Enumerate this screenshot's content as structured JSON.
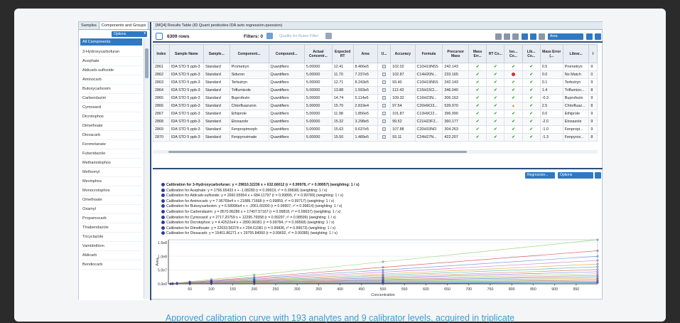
{
  "left_panel": {
    "tabs": [
      "Samples",
      "Components and Groups"
    ],
    "dropdown": "Options",
    "selected": "All Components",
    "items": [
      "3-Hydroxycarbofuran",
      "Acephate",
      "Aldicarb-sulfoxide",
      "Aminocarb",
      "Butoxycarboxim",
      "Carbendazim",
      "Cymoxanil",
      "Dicrotophos",
      "Dimethoate",
      "Dioxacarb",
      "Fenmetanate",
      "Fuberidazole",
      "Methamidophos",
      "Methomyl",
      "Mevinphos",
      "Monocrotophos",
      "Omethoate",
      "Oxamyl",
      "Propamocarb",
      "Thiabendazole",
      "Tricyclazole",
      "Vamidothion",
      "Aldicarb",
      "Bendiocarb"
    ]
  },
  "results": {
    "title": "[MQ4] Results Table (ID Quant pesticides IDA avto regression.qsession)",
    "rows_label": "6309 rows",
    "filters_label": "Filters: 0",
    "quality_filter": "Quality for Rules Filter",
    "metric_dropdown": "Area",
    "columns": [
      "Index",
      "Sample Name",
      "Sample...",
      "Component...",
      "Compound...",
      "Actual Concentr...",
      "Expected RT",
      "Area",
      "U...",
      "Accuracy",
      "Formula",
      "Precursor Mass",
      "Mass Err...",
      "RT Co...",
      "Iso... Co...",
      "Lib... Co...",
      "Mass Error (...",
      "Librar...",
      "I"
    ],
    "rows": [
      [
        "2861",
        "IDA STD 5 ppb-3",
        "Standard",
        "Prometryn",
        "Quantifiers",
        "5.00000",
        "12.41",
        "8.466e5",
        "",
        "102.02",
        "C10H19N5S",
        "242.143",
        "ok",
        "ok",
        "ok",
        "ok",
        "0.5",
        "Prometryn",
        "9"
      ],
      [
        "2862",
        "IDA STD 5 ppb-3",
        "Standard",
        "Siduron",
        "Quantifiers",
        "5.00000",
        "11.70",
        "7.237e5",
        "",
        "102.87",
        "C14H20N...",
        "233.165",
        "ok",
        "ok",
        "err",
        "ok",
        "0.0",
        "No Match",
        "0"
      ],
      [
        "2863",
        "IDA STD 5 ppb-3",
        "Standard",
        "Terbutryn",
        "Quantifiers",
        "5.00000",
        "12.71",
        "8.243e5",
        "",
        "93.40",
        "C10H19N5S",
        "242.143",
        "ok",
        "ok",
        "ok",
        "ok",
        "0.1",
        "Terbutryn",
        "9"
      ],
      [
        "2864",
        "IDA STD 5 ppb-3",
        "Standard",
        "Triflumizole",
        "Quantifiers",
        "5.00000",
        "13.88",
        "1.593e5",
        "",
        "112.43",
        "C15H15Cl...",
        "346.040",
        "ok",
        "ok",
        "ok",
        "ok",
        "1.4",
        "Triflumizo...",
        "8"
      ],
      [
        "2865",
        "IDA STD 5 ppb-3",
        "Standard",
        "Buprofezin",
        "Quantifiers",
        "5.00000",
        "14.74",
        "5.114e5",
        "",
        "109.32",
        "C16H23N...",
        "306.163",
        "ok",
        "ok",
        "ok",
        "ok",
        "-0.3",
        "Buprofezin",
        "9"
      ],
      [
        "2866",
        "IDA STD 5 ppb-3",
        "Standard",
        "Chlorfluazuron",
        "Quantifiers",
        "5.00000",
        "15.70",
        "2.819e4",
        "",
        "97.54",
        "C20H9Cl3...",
        "539.970",
        "ok",
        "ok",
        "warn",
        "ok",
        "2.5",
        "Chlorfluaz...",
        "8"
      ],
      [
        "2867",
        "IDA STD 5 ppb-3",
        "Standard",
        "Ethiprole",
        "Quantifiers",
        "5.00000",
        "11.98",
        "1.856e5",
        "",
        "101.87",
        "C13H9Cl2...",
        "396.990",
        "ok",
        "ok",
        "ok",
        "ok",
        "0.0",
        "Ethiprole",
        "9"
      ],
      [
        "2868",
        "IDA STD 5 ppb-3",
        "Standard",
        "Etoxazole",
        "Quantifiers",
        "5.00000",
        "15.32",
        "3.298e5",
        "",
        "99.52",
        "C21H23F2...",
        "360.177",
        "ok",
        "ok",
        "ok",
        "ok",
        "-2.0",
        "Etoxazole",
        "9"
      ],
      [
        "2869",
        "IDA STD 5 ppb-3",
        "Standard",
        "Fenpropimorph",
        "Quantifiers",
        "5.00000",
        "15.63",
        "9.637e5",
        "",
        "107.88",
        "C20H33NO",
        "304.263",
        "ok",
        "ok",
        "ok",
        "ok",
        "-1.0",
        "Fenpropi...",
        "9"
      ],
      [
        "2870",
        "IDA STD 5 ppb-3",
        "Standard",
        "Fenpyroximate",
        "Quantifiers",
        "5.00000",
        "15.50",
        "1.489e5",
        "",
        "93.11",
        "C24H27N...",
        "422.207",
        "ok",
        "ok",
        "ok",
        "ok",
        "-1.3",
        "Fenpyrox...",
        "8"
      ]
    ]
  },
  "calibration": {
    "dropdown_a": "Regression...",
    "dropdown_b": "Options",
    "legend": [
      "Calibration for 3-Hydroxycarbofuran: y = 29810.32236 x + 632.66012 (r = 0.99978, r² = 0.99957) (weighting: 1 / x)",
      "Calibration for Acephate: y = 1766.65433 x + -1.08280 (r = 0.99919, r² = 0.99838) (weighting: 1 / x)",
      "Calibration for Aldicarb-sulfoxide: y = 2660.65954 x + 684.11797 (r = 0.99895, r² = 0.99789) (weighting: 1 / x)",
      "Calibration for Aminocarb: y = 7.96769e4 x + 21886.71668 (r = 0.99859, r² = 0.99717) (weighting: 1 / x)",
      "Calibration for Butoxycarboxim: y = 6.58996e4 x + -2061.69300 (r = 0.99907, r² = 0.99814) (weighting: 1 / x)",
      "Calibration for Carbendazim: y = 8570.86286 x + 17407.57167 (r = 0.99818, r² = 0.99637) (weighting: 1 / x)",
      "Calibration for Cymoxanil: y = 2717.20759 x + 12295.76558 (r = 0.99297, r² = 0.98599) (weighting: 1 / x)",
      "Calibration for Dicrotophos: y = 4.42522e4 x + 2890.96081 (r = 0.99784, r² = 0.99568) (weighting: 1 / x)",
      "Calibration for Dimethoate: y = 22033.56374 x + 294.61081 (r = 0.99836, r² = 0.99673) (weighting: 1 / x)",
      "Calibration for Dioxacarb: y = 15401.86271 x + 29755.84060 (r = 0.99692, r² = 0.99385) (weighting: 1 / x)"
    ]
  },
  "chart_data": {
    "type": "line",
    "title": "",
    "xlabel": "Concentration",
    "ylabel": "Area",
    "xlim": [
      0,
      1000
    ],
    "ylim": [
      0,
      160000000.0
    ],
    "x_ticks": [
      50,
      100,
      150,
      200,
      250,
      300,
      350,
      400,
      450,
      500,
      550,
      600,
      650,
      700,
      750,
      800,
      850,
      900,
      950
    ],
    "y_ticks": [
      "0.0e0",
      "5.0e7",
      "1.0e8",
      "1.5e8"
    ],
    "y_tick_values": [
      0,
      50000000.0,
      100000000.0,
      150000000.0
    ],
    "series": [
      {
        "slope": 160000,
        "color": "#8fd16a"
      },
      {
        "slope": 120000,
        "color": "#d24b4b"
      },
      {
        "slope": 100000,
        "color": "#5f8fd6"
      },
      {
        "slope": 85000,
        "color": "#c86ecb"
      },
      {
        "slope": 72000,
        "color": "#e0a23a"
      },
      {
        "slope": 62000,
        "color": "#4bb3a6"
      },
      {
        "slope": 52000,
        "color": "#d67a5f"
      },
      {
        "slope": 44000,
        "color": "#7a6fd6"
      },
      {
        "slope": 37000,
        "color": "#9ccf4b"
      },
      {
        "slope": 31000,
        "color": "#e06a9a"
      },
      {
        "slope": 26000,
        "color": "#4b8fcf"
      },
      {
        "slope": 21000,
        "color": "#cfb54b"
      },
      {
        "slope": 17000,
        "color": "#6fcf8f"
      },
      {
        "slope": 13000,
        "color": "#cf6f4b"
      },
      {
        "slope": 9500,
        "color": "#8f6fcf"
      },
      {
        "slope": 6500,
        "color": "#4bcfcf"
      },
      {
        "slope": 3500,
        "color": "#2d3d9e"
      }
    ]
  },
  "caption": "Approved calibration curve with 193 analytes and 9 calibrator levels, acquired in triplicate"
}
